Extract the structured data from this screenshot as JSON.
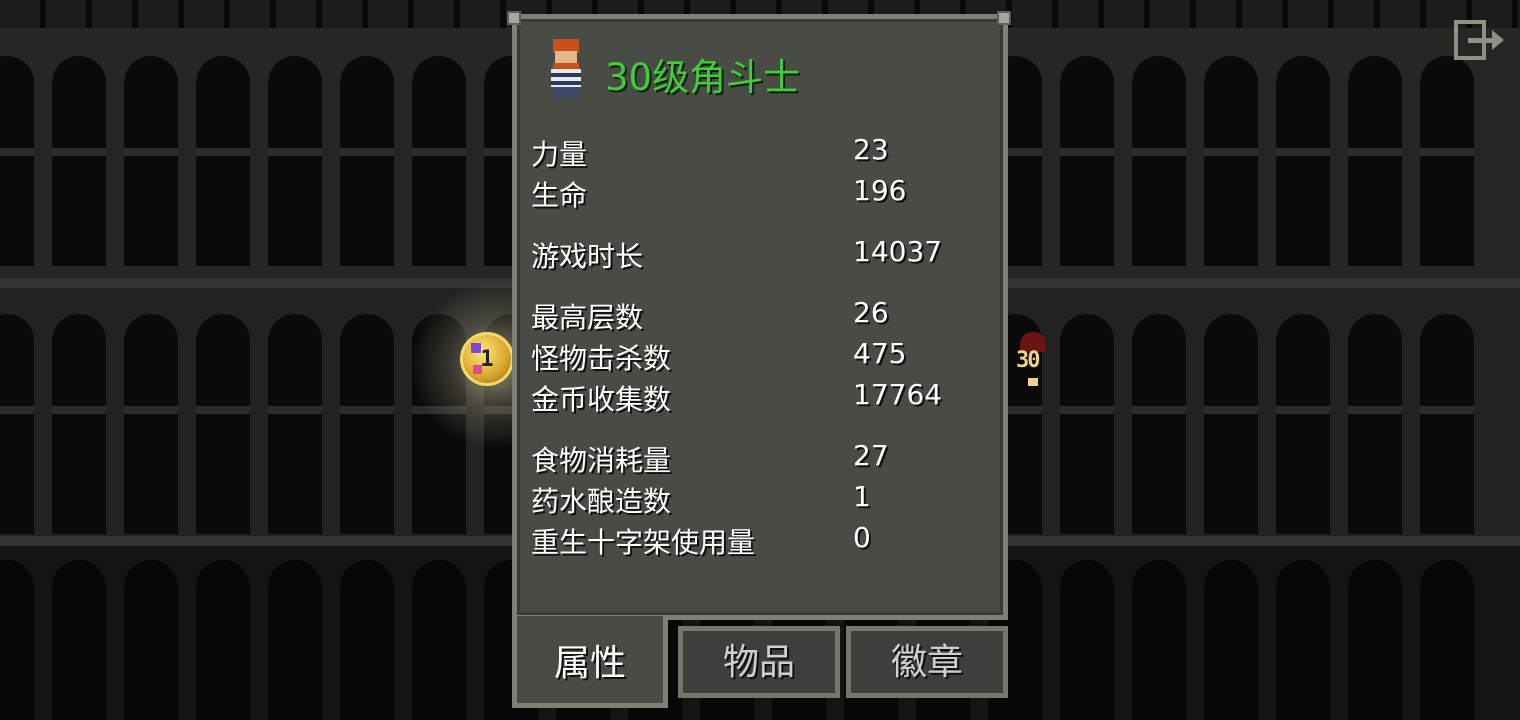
{
  "header": {
    "title": "30级角斗士",
    "hero_icon": "gladiator-sprite"
  },
  "stats": [
    {
      "label": "力量",
      "value": "23"
    },
    {
      "label": "生命",
      "value": "196"
    },
    {
      "label": "游戏时长",
      "value": "14037"
    },
    {
      "label": "最高层数",
      "value": "26"
    },
    {
      "label": "怪物击杀数",
      "value": "475"
    },
    {
      "label": "金币收集数",
      "value": "17764"
    },
    {
      "label": "食物消耗量",
      "value": "27"
    },
    {
      "label": "药水酿造数",
      "value": "1"
    },
    {
      "label": "重生十字架使用量",
      "value": "0"
    }
  ],
  "tabs": [
    {
      "label": "属性",
      "active": true
    },
    {
      "label": "物品",
      "active": false
    },
    {
      "label": "徽章",
      "active": false
    }
  ],
  "badge": {
    "number": "1"
  },
  "enemy": {
    "level": "30"
  },
  "colors": {
    "title": "#3fce3a",
    "panel": "#494b45",
    "panel_border": "#7e8276",
    "text": "#ffffff"
  },
  "icons": {
    "exit": "exit-icon"
  }
}
